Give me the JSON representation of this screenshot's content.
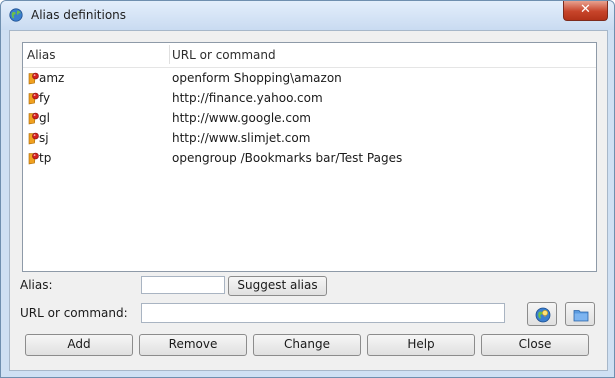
{
  "window": {
    "title": "Alias definitions",
    "close_glyph": "✕"
  },
  "list": {
    "columns": {
      "alias": "Alias",
      "url": "URL or command"
    },
    "rows": [
      {
        "alias": "amz",
        "url": "openform Shopping\\amazon"
      },
      {
        "alias": "fy",
        "url": "http://finance.yahoo.com"
      },
      {
        "alias": "gl",
        "url": "http://www.google.com"
      },
      {
        "alias": "sj",
        "url": "http://www.slimjet.com"
      },
      {
        "alias": "tp",
        "url": "opengroup /Bookmarks bar/Test Pages"
      }
    ],
    "row_icon": "bookmark-alias-icon"
  },
  "form": {
    "alias_label": "Alias:",
    "alias_value": "",
    "suggest_label": "Suggest alias",
    "url_label": "URL or command:",
    "url_value": "",
    "lookup_icon": "globe-bulb-icon",
    "folder_icon": "folder-icon"
  },
  "buttons": {
    "add": "Add",
    "remove": "Remove",
    "change": "Change",
    "help": "Help",
    "close": "Close"
  },
  "colors": {
    "title_bar": "#c9dbf1",
    "close_button": "#c7442a",
    "dialog_face": "#f0f0f0",
    "icon_orange": "#f0a020",
    "icon_red": "#d02020"
  }
}
